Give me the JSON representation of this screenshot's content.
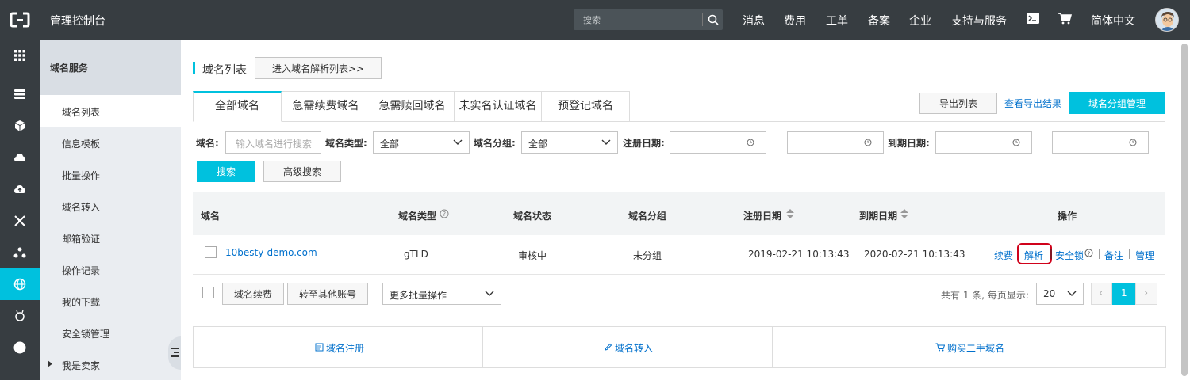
{
  "topbar": {
    "title": "管理控制台",
    "search_placeholder": "搜索",
    "nav": [
      "消息",
      "费用",
      "工单",
      "备案",
      "企业",
      "支持与服务"
    ],
    "language": "简体中文"
  },
  "rail": {
    "items": [
      "grid-icon",
      "list-icon",
      "cube-icon",
      "cloud-icon",
      "cloud-upload-icon",
      "network-icon",
      "share-icon",
      "globe-icon",
      "snail-icon",
      "circle-icon"
    ],
    "active_index": 7
  },
  "sidebar": {
    "header": "域名服务",
    "items": [
      "域名列表",
      "信息模板",
      "批量操作",
      "域名转入",
      "邮箱验证",
      "操作记录",
      "我的下载",
      "安全锁管理",
      "我是卖家"
    ],
    "active_index": 0
  },
  "page": {
    "title": "域名列表",
    "goto_dns_button": "进入域名解析列表>>",
    "tabs": [
      "全部域名",
      "急需续费域名",
      "急需赎回域名",
      "未实名认证域名",
      "预登记域名"
    ],
    "active_tab": 0,
    "export_button": "导出列表",
    "view_export_link": "查看导出结果",
    "group_manage_button": "域名分组管理"
  },
  "filters": {
    "domain_label": "域名:",
    "domain_placeholder": "输入域名进行搜索",
    "type_label": "域名类型:",
    "type_value": "全部",
    "group_label": "域名分组:",
    "group_value": "全部",
    "reg_date_label": "注册日期:",
    "expire_date_label": "到期日期:",
    "dash": "-",
    "search_button": "搜索",
    "advanced_button": "高级搜索"
  },
  "table": {
    "headers": [
      "域名",
      "域名类型",
      "域名状态",
      "域名分组",
      "注册日期",
      "到期日期",
      "操作"
    ],
    "rows": [
      {
        "domain": "10besty-demo.com",
        "type": "gTLD",
        "status": "审核中",
        "group": "未分组",
        "registered": "2019-02-21 10:13:43",
        "expires": "2020-02-21 10:13:43",
        "actions": [
          "续费",
          "解析",
          "安全锁",
          "备注",
          "管理"
        ]
      }
    ],
    "op_sep": "|"
  },
  "footer_bar": {
    "renew_button": "域名续费",
    "transfer_button": "转至其他账号",
    "batch_select": "更多批量操作",
    "total_text": "共有 1 条, 每页显示:",
    "page_size": "20",
    "current_page": "1",
    "prev": "‹",
    "next": "›"
  },
  "bottom_links": [
    "域名注册",
    "域名转入",
    "购买二手域名"
  ],
  "colors": {
    "accent": "#00c1de",
    "link": "#0070cc",
    "topbar": "#373d41",
    "highlight": "#d0021b"
  }
}
